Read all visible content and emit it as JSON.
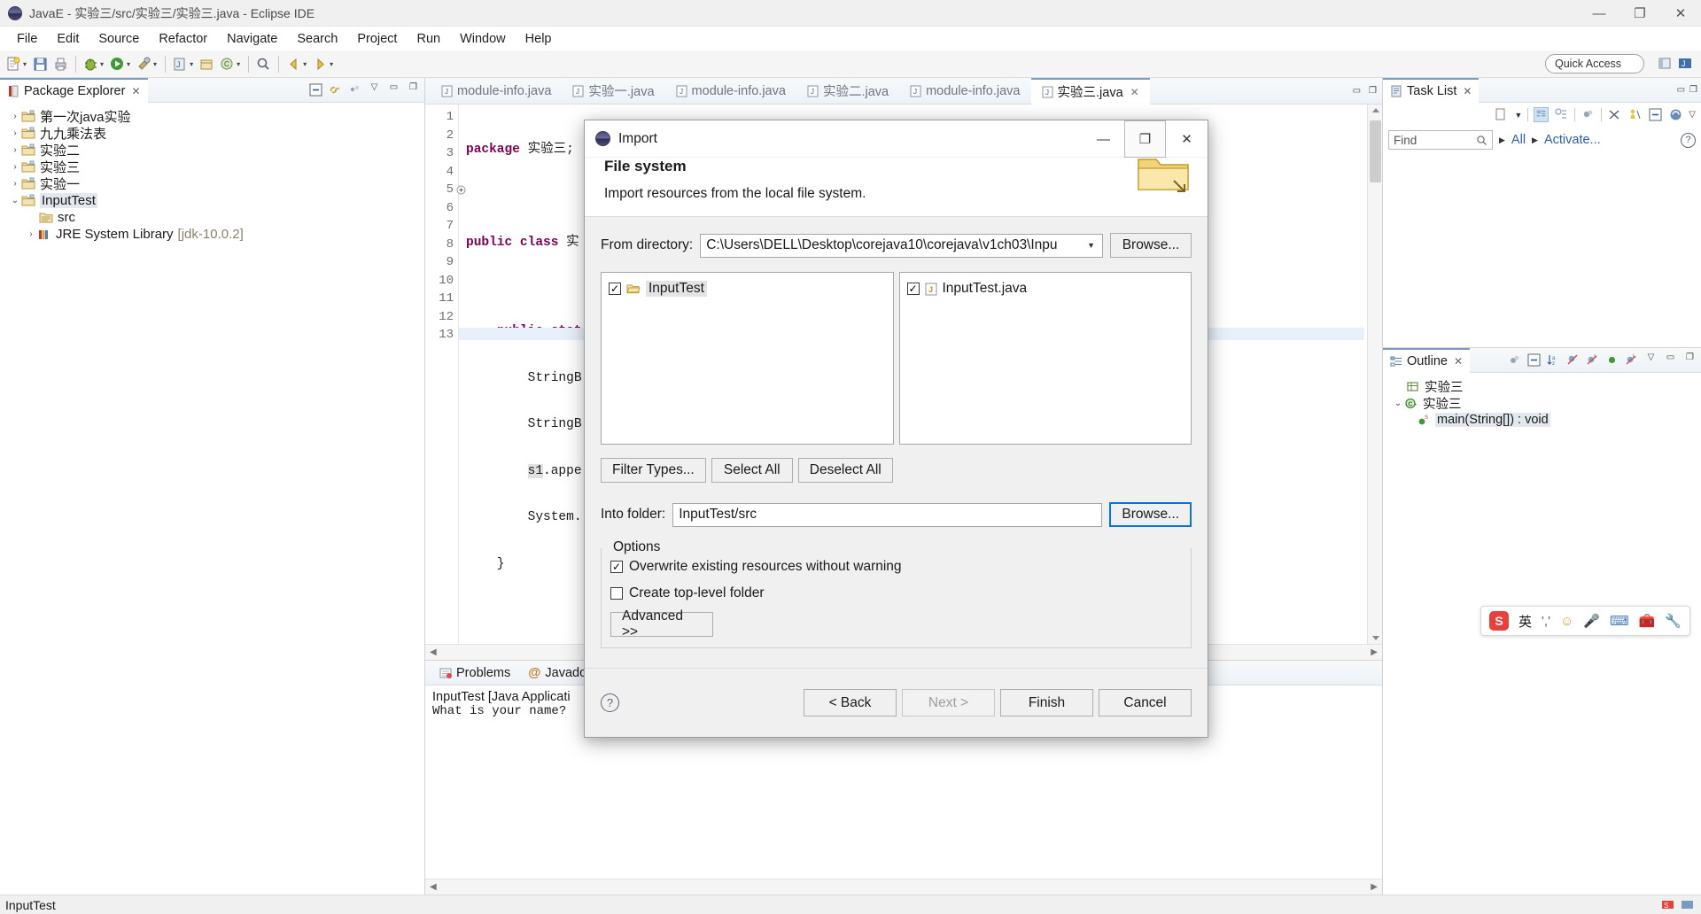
{
  "window": {
    "title": "JavaE - 实验三/src/实验三/实验三.java - Eclipse IDE",
    "minimize": "—",
    "maximize": "❐",
    "close": "✕"
  },
  "menu": [
    "File",
    "Edit",
    "Source",
    "Refactor",
    "Navigate",
    "Search",
    "Project",
    "Run",
    "Window",
    "Help"
  ],
  "toolbar": {
    "quick_access": "Quick Access"
  },
  "package_explorer": {
    "tab_label": "Package Explorer",
    "close": "✕",
    "items": [
      {
        "label": "第一次java实验",
        "arrow": "›",
        "indent": 0,
        "icon": "project-folder-icon",
        "selected": false
      },
      {
        "label": "九九乘法表",
        "arrow": "›",
        "indent": 0,
        "icon": "project-folder-icon",
        "selected": false
      },
      {
        "label": "实验二",
        "arrow": "›",
        "indent": 0,
        "icon": "project-folder-icon",
        "selected": false
      },
      {
        "label": "实验三",
        "arrow": "›",
        "indent": 0,
        "icon": "project-folder-icon",
        "selected": false
      },
      {
        "label": "实验一",
        "arrow": "›",
        "indent": 0,
        "icon": "project-folder-icon",
        "selected": false
      },
      {
        "label": "InputTest",
        "arrow": "⌄",
        "indent": 0,
        "icon": "project-folder-icon",
        "selected": true
      },
      {
        "label": "src",
        "arrow": "",
        "indent": 1,
        "icon": "source-folder-icon",
        "selected": false
      },
      {
        "label": "JRE System Library",
        "suffix": "[jdk-10.0.2]",
        "arrow": "›",
        "indent": 1,
        "icon": "library-icon",
        "selected": false
      }
    ]
  },
  "editor": {
    "tabs": [
      {
        "label": "module-info.java",
        "active": false
      },
      {
        "label": "实验一.java",
        "active": false
      },
      {
        "label": "module-info.java",
        "active": false
      },
      {
        "label": "实验二.java",
        "active": false
      },
      {
        "label": "module-info.java",
        "active": false
      },
      {
        "label": "实验三.java",
        "active": true
      }
    ],
    "close_x": "✕",
    "gutter": [
      "1",
      "2",
      "3",
      "4",
      "5",
      "6",
      "7",
      "8",
      "9",
      "10",
      "11",
      "12",
      "13"
    ],
    "code_lines": [
      {
        "n": 1,
        "text": "package 实验三;",
        "kw": "package"
      },
      {
        "n": 2,
        "text": ""
      },
      {
        "n": 3,
        "text": "public class 实",
        "kw": "public class"
      },
      {
        "n": 4,
        "text": ""
      },
      {
        "n": 5,
        "text": "    public stat",
        "kw": "public stat"
      },
      {
        "n": 6,
        "text": "        StringB"
      },
      {
        "n": 7,
        "text": "        StringB"
      },
      {
        "n": 8,
        "text": "        s1.appe"
      },
      {
        "n": 9,
        "text": "        System."
      },
      {
        "n": 10,
        "text": "    }"
      },
      {
        "n": 11,
        "text": ""
      },
      {
        "n": 12,
        "text": "}"
      },
      {
        "n": 13,
        "text": ""
      }
    ]
  },
  "bottom": {
    "tabs": [
      {
        "label": "Problems",
        "active": false
      },
      {
        "label": "Javadoc",
        "active": false
      }
    ],
    "console_header": "InputTest [Java Applicati",
    "console_output": "What is your name?"
  },
  "task_list": {
    "tab_label": "Task List",
    "close": "✕",
    "find_placeholder": "Find",
    "filter_all": "All",
    "activate": "Activate..."
  },
  "outline": {
    "tab_label": "Outline",
    "close": "✕",
    "items": [
      {
        "label": "实验三",
        "arrow": "",
        "indent": 1,
        "icon": "package-icon",
        "selected": false
      },
      {
        "label": "实验三",
        "arrow": "⌄",
        "indent": 0,
        "icon": "class-icon",
        "selected": false
      },
      {
        "label": "main(String[]) : void",
        "arrow": "",
        "indent": 2,
        "icon": "method-static-icon",
        "selected": true
      }
    ]
  },
  "status_bar": {
    "text": "InputTest"
  },
  "dialog": {
    "title": "Import",
    "minimize": "—",
    "maximize": "❐",
    "close": "✕",
    "heading": "File system",
    "description": "Import resources from the local file system.",
    "from_directory_label": "From directory:",
    "from_directory_value": "C:\\Users\\DELL\\Desktop\\corejava10\\corejava\\v1ch03\\Inpu",
    "browse_top_label": "Browse...",
    "left_tree": [
      {
        "label": "InputTest",
        "checked": true,
        "icon": "folder-open-icon",
        "selected": true
      }
    ],
    "right_list": [
      {
        "label": "InputTest.java",
        "checked": true,
        "icon": "java-file-icon",
        "selected": false
      }
    ],
    "filter_types_label": "Filter Types...",
    "select_all_label": "Select All",
    "deselect_all_label": "Deselect All",
    "into_folder_label": "Into folder:",
    "into_folder_value": "InputTest/src",
    "browse_into_label": "Browse...",
    "options_legend": "Options",
    "option_overwrite": "Overwrite existing resources without warning",
    "option_overwrite_checked": true,
    "option_topfolder": "Create top-level folder",
    "option_topfolder_checked": false,
    "advanced_label": "Advanced >>",
    "help_glyph": "?",
    "back_label": "< Back",
    "next_label": "Next >",
    "finish_label": "Finish",
    "cancel_label": "Cancel",
    "checkmark": "✓"
  },
  "ime": {
    "mode": "英",
    "logo": "S"
  },
  "colors": {
    "accent_blue": "#0078d7",
    "tab_blue": "#7a9bc0",
    "keyword_purple": "#7f0055",
    "link_blue": "#2a5db0",
    "dim_brown": "#8a7f6a"
  }
}
